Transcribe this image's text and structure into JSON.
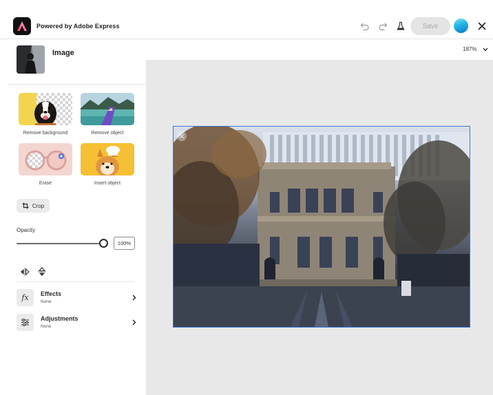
{
  "app": {
    "title": "Powered by Adobe Express",
    "save_label": "Save",
    "brand_color": "#FA0F00"
  },
  "panel": {
    "title": "Image",
    "quick_actions": [
      {
        "label": "Remove background",
        "icon": "dog-cutout-preview"
      },
      {
        "label": "Remove object",
        "icon": "lake-boat-preview"
      },
      {
        "label": "Erase",
        "icon": "glasses-preview"
      },
      {
        "label": "Insert object",
        "icon": "dog-hat-preview"
      }
    ],
    "crop_label": "Crop",
    "opacity": {
      "label": "Opacity",
      "value": "100%",
      "fraction": 1.0
    },
    "rows": [
      {
        "title": "Effects",
        "subtitle": "None",
        "icon": "fx-icon"
      },
      {
        "title": "Adjustments",
        "subtitle": "None",
        "icon": "sliders-icon"
      }
    ]
  },
  "canvas": {
    "zoom": "187%",
    "selection_color": "#3D77D6"
  }
}
